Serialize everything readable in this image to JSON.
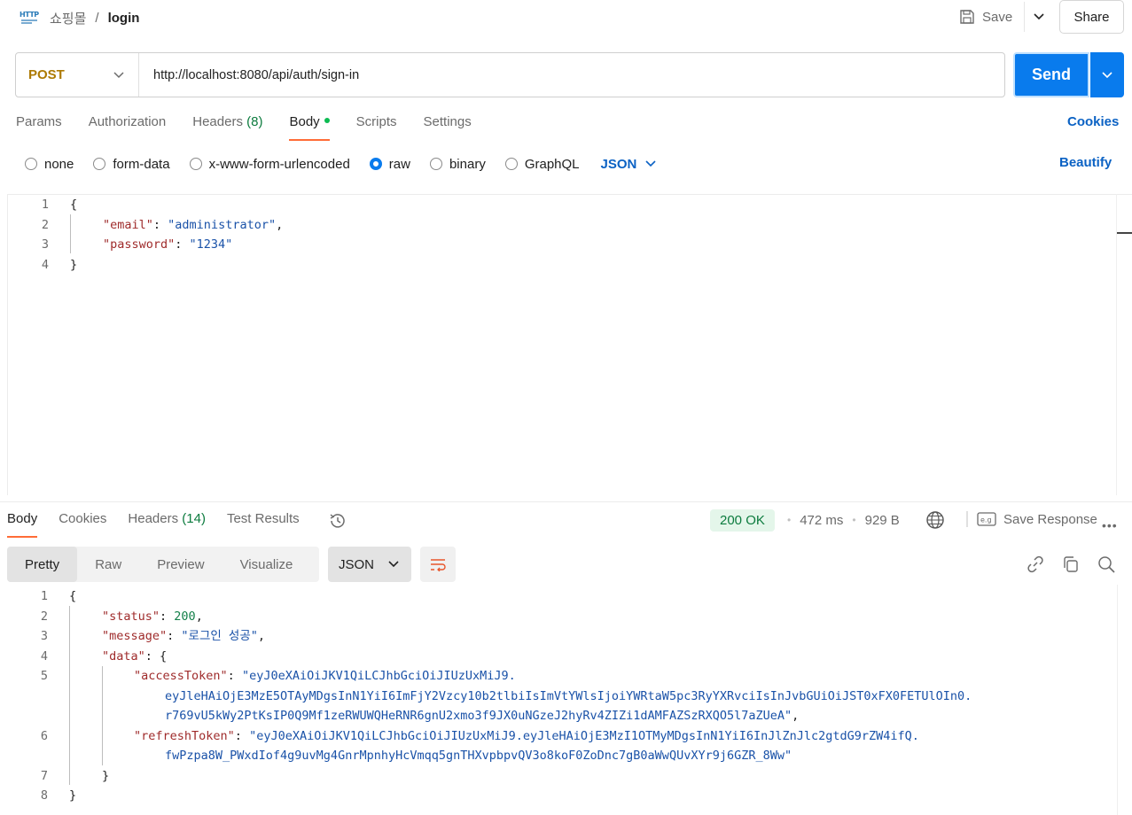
{
  "header": {
    "http_badge": "HTTP",
    "collection": "쇼핑몰",
    "separator": "/",
    "request_name": "login",
    "save_label": "Save",
    "share_label": "Share"
  },
  "request": {
    "method": "POST",
    "url": "http://localhost:8080/api/auth/sign-in",
    "send_label": "Send",
    "tabs": [
      {
        "label": "Params"
      },
      {
        "label": "Authorization"
      },
      {
        "label": "Headers",
        "count": "(8)"
      },
      {
        "label": "Body"
      },
      {
        "label": "Scripts"
      },
      {
        "label": "Settings"
      }
    ],
    "active_tab": "Body",
    "cookies_label": "Cookies",
    "body_types": [
      "none",
      "form-data",
      "x-www-form-urlencoded",
      "raw",
      "binary",
      "GraphQL"
    ],
    "selected_body_type": "raw",
    "format": "JSON",
    "beautify_label": "Beautify",
    "body_lines": [
      "1",
      "2",
      "3",
      "4"
    ],
    "body": {
      "open": "{",
      "email_key": "\"email\"",
      "email_value": "\"administrator\"",
      "password_key": "\"password\"",
      "password_value": "\"1234\"",
      "close": "}"
    }
  },
  "response": {
    "tabs": [
      {
        "label": "Body"
      },
      {
        "label": "Cookies"
      },
      {
        "label": "Headers",
        "count": "(14)"
      },
      {
        "label": "Test Results"
      }
    ],
    "status": "200 OK",
    "time": "472 ms",
    "size": "929 B",
    "save_response_label": "Save Response",
    "view_modes": [
      "Pretty",
      "Raw",
      "Preview",
      "Visualize"
    ],
    "active_view": "Pretty",
    "format": "JSON",
    "lines": [
      "1",
      "2",
      "3",
      "4",
      "5",
      "6",
      "7",
      "8"
    ],
    "json": {
      "status_key": "\"status\"",
      "status_value": "200",
      "message_key": "\"message\"",
      "message_value": "\"로그인 성공\"",
      "data_key": "\"data\"",
      "access_key": "\"accessToken\"",
      "access_part1": "\"eyJ0eXAiOiJKV1QiLCJhbGciOiJIUzUxMiJ9.",
      "access_part2": "eyJleHAiOjE3MzE5OTAyMDgsInN1YiI6ImFjY2Vzcy10b2tlbiIsImVtYWlsIjoiYWRtaW5pc3RyYXRvciIsInJvbGUiOiJST0xFX0FETUlOIn0.",
      "access_part3": "r769vU5kWy2PtKsIP0Q9Mf1zeRWUWQHeRNR6gnU2xmo3f9JX0uNGzeJ2hyRv4ZIZi1dAMFAZSzRXQO5l7aZUeA\"",
      "refresh_key": "\"refreshToken\"",
      "refresh_part1": "\"eyJ0eXAiOiJKV1QiLCJhbGciOiJIUzUxMiJ9.eyJleHAiOjE3MzI1OTMyMDgsInN1YiI6InJlZnJlc2gtdG9rZW4ifQ.",
      "refresh_part2": "fwPzpa8W_PWxdIof4g9uvMg4GnrMpnhyHcVmqq5gnTHXvpbpvQV3o8koF0ZoDnc7gB0aWwQUvXYr9j6GZR_8Ww\""
    }
  },
  "colors": {
    "accent": "#097bed",
    "method": "#ad7a03",
    "active_underline": "#ff6c37",
    "status_ok": "#0c7b3e"
  }
}
